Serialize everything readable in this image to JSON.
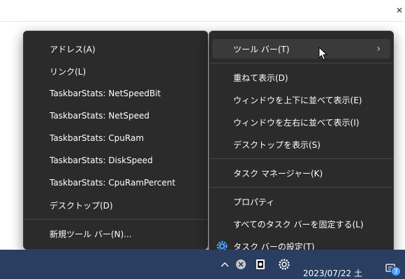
{
  "submenu": {
    "items": [
      {
        "label": "アドレス(A)"
      },
      {
        "label": "リンク(L)"
      },
      {
        "label": "TaskbarStats: NetSpeedBit"
      },
      {
        "label": "TaskbarStats: NetSpeed"
      },
      {
        "label": "TaskbarStats: CpuRam"
      },
      {
        "label": "TaskbarStats: DiskSpeed"
      },
      {
        "label": "TaskbarStats: CpuRamPercent"
      },
      {
        "label": "デスクトップ(D)"
      }
    ],
    "new_toolbar": "新規ツール バー(N)..."
  },
  "mainmenu": {
    "toolbar": "ツール バー(T)",
    "cascade": "重ねて表示(D)",
    "stacked": "ウィンドウを上下に並べて表示(E)",
    "side_by_side": "ウィンドウを左右に並べて表示(I)",
    "show_desktop": "デスクトップを表示(S)",
    "task_manager": "タスク マネージャー(K)",
    "properties": "プロパティ",
    "lock_taskbars": "すべてのタスク バーを固定する(L)",
    "taskbar_settings": "タスク バーの設定(T)"
  },
  "taskbar": {
    "date": "2023/07/22 土",
    "notification_count": "7"
  },
  "colors": {
    "menu_bg": "#2b2b2b",
    "hover_bg": "#3a3a3a",
    "taskbar_bg": "#2a3e62",
    "accent": "#4aa3ff"
  },
  "icons": [
    "chevron-right-icon",
    "gear-icon",
    "mouse-cursor-icon",
    "chevron-up-icon",
    "close-circle-icon",
    "app-tray-icon",
    "settings-tray-icon",
    "notification-icon"
  ]
}
